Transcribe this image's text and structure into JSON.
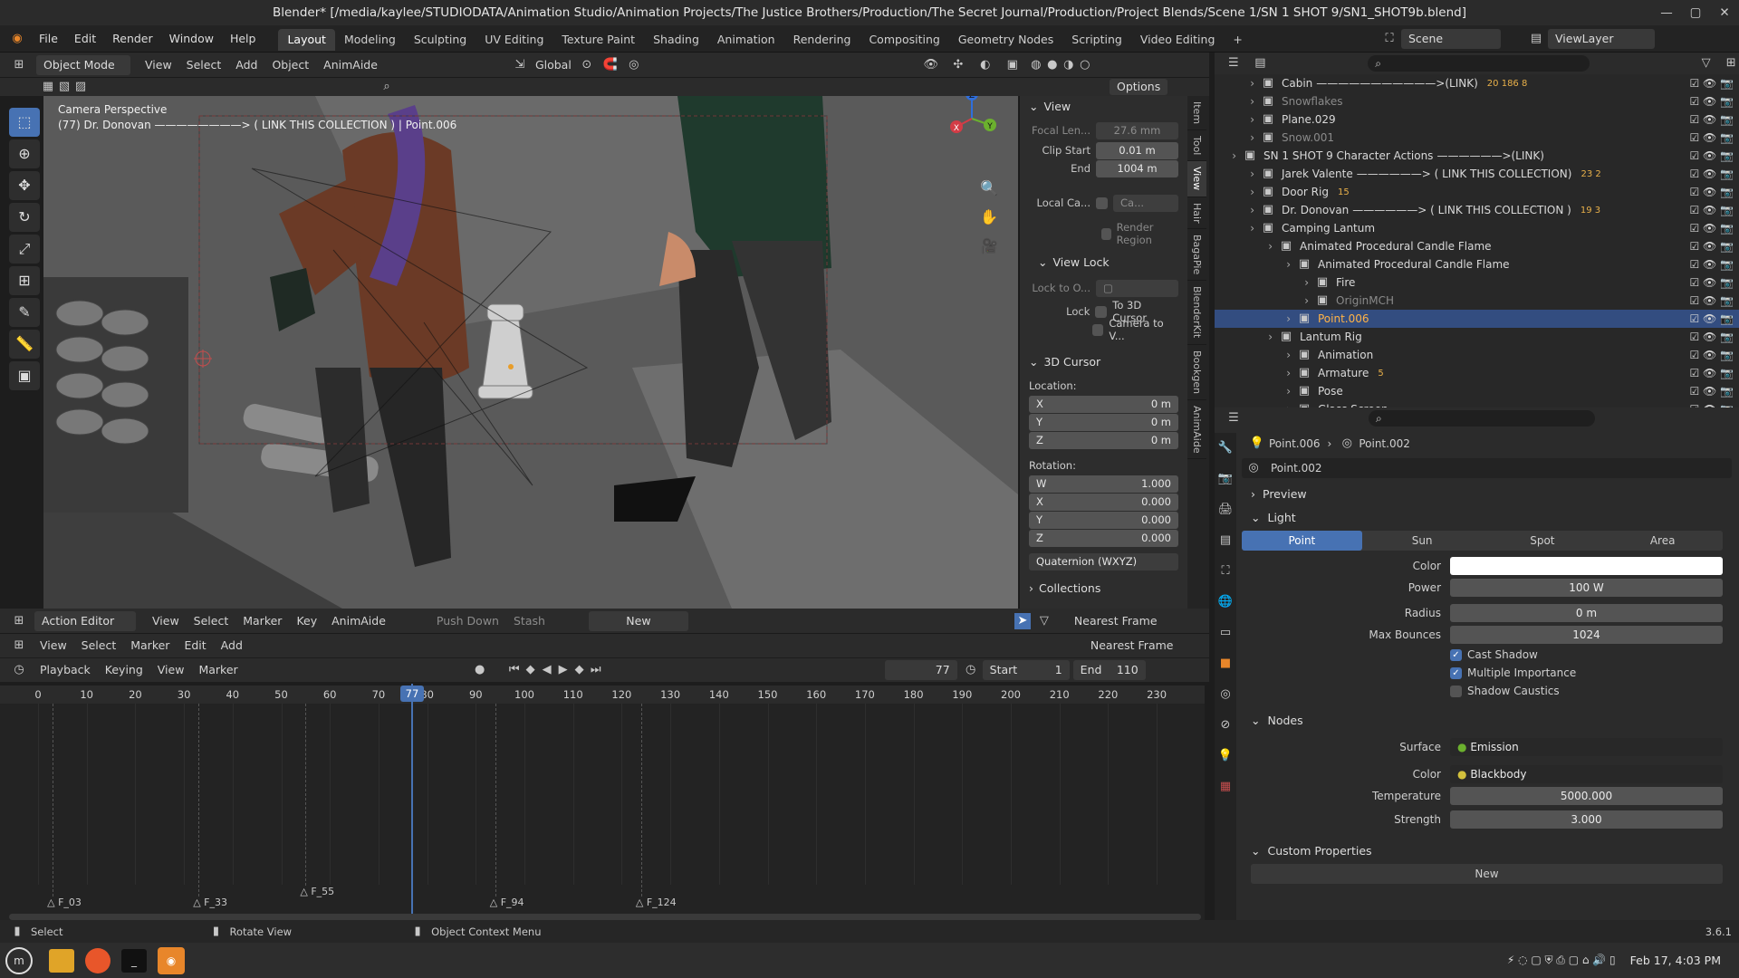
{
  "window": {
    "title": "Blender* [/media/kaylee/STUDIODATA/Animation Studio/Animation Projects/The Justice Brothers/Production/The Secret Journal/Production/Project Blends/Scene 1/SN 1 SHOT 9/SN1_SHOT9b.blend]"
  },
  "menu": {
    "items": [
      "File",
      "Edit",
      "Render",
      "Window",
      "Help"
    ]
  },
  "workspaces": [
    "Layout",
    "Modeling",
    "Sculpting",
    "UV Editing",
    "Texture Paint",
    "Shading",
    "Animation",
    "Rendering",
    "Compositing",
    "Geometry Nodes",
    "Scripting",
    "Video Editing"
  ],
  "scene": {
    "label": "Scene",
    "view_layer": "ViewLayer"
  },
  "viewport_header": {
    "mode": "Object Mode",
    "items": [
      "View",
      "Select",
      "Add",
      "Object",
      "AnimAide"
    ],
    "orientation": "Global",
    "options": "Options"
  },
  "viewport": {
    "camera_title": "Camera Perspective",
    "camera_subtitle": "(77) Dr. Donovan ————————> ( LINK THIS COLLECTION ) | Point.006",
    "axis": {
      "x": "X",
      "y": "Y",
      "z": "Z"
    }
  },
  "npanel": {
    "view_title": "View",
    "focal_label": "Focal Len...",
    "focal_value": "27.6 mm",
    "clip_start_label": "Clip Start",
    "clip_start_value": "0.01 m",
    "clip_end_label": "End",
    "clip_end_value": "1004 m",
    "local_cam_label": "Local Ca...",
    "local_cam_value": "Ca...",
    "render_region": "Render Region",
    "view_lock_title": "View Lock",
    "lock_to_label": "Lock to O...",
    "lock_label": "Lock",
    "to_cursor": "To 3D Cursor",
    "camera_to_view": "Camera to V...",
    "cursor_title": "3D Cursor",
    "location_label": "Location:",
    "loc": [
      {
        "axis": "X",
        "value": "0 m"
      },
      {
        "axis": "Y",
        "value": "0 m"
      },
      {
        "axis": "Z",
        "value": "0 m"
      }
    ],
    "rotation_label": "Rotation:",
    "rot": [
      {
        "axis": "W",
        "value": "1.000"
      },
      {
        "axis": "X",
        "value": "0.000"
      },
      {
        "axis": "Y",
        "value": "0.000"
      },
      {
        "axis": "Z",
        "value": "0.000"
      }
    ],
    "rotation_mode": "Quaternion (WXYZ)",
    "collections_title": "Collections",
    "side_tabs": [
      "Item",
      "Tool",
      "View",
      "Hair",
      "BagaPie",
      "BlenderKit",
      "Bookgen",
      "AnimAide"
    ]
  },
  "outliner": {
    "rows": [
      {
        "name": "Cabin",
        "suffix": "———————————>(LINK)",
        "badge": "20 186 8",
        "indent": 1
      },
      {
        "name": "Snowflakes",
        "suffix": "",
        "badge": "",
        "indent": 1,
        "dim": true
      },
      {
        "name": "Plane.029",
        "suffix": "",
        "badge": "",
        "indent": 1
      },
      {
        "name": "Snow.001",
        "suffix": "",
        "badge": "",
        "indent": 1,
        "dim": true
      },
      {
        "name": "SN 1 SHOT 9 Character Actions",
        "suffix": "——————>(LINK)",
        "badge": "",
        "indent": 0
      },
      {
        "name": "Jarek Valente",
        "suffix": "——————> ( LINK THIS COLLECTION)",
        "badge": "23 2",
        "indent": 1
      },
      {
        "name": "Door Rig",
        "suffix": "",
        "badge": "15",
        "indent": 1
      },
      {
        "name": "Dr. Donovan",
        "suffix": "——————> ( LINK THIS COLLECTION )",
        "badge": "19 3",
        "indent": 1
      },
      {
        "name": "Camping Lantum",
        "suffix": "",
        "badge": "",
        "indent": 1
      },
      {
        "name": "Animated Procedural Candle Flame",
        "suffix": "",
        "badge": "",
        "indent": 2
      },
      {
        "name": "Animated Procedural Candle Flame",
        "suffix": "",
        "badge": "",
        "indent": 3
      },
      {
        "name": "Fire",
        "suffix": "",
        "badge": "",
        "indent": 4
      },
      {
        "name": "OriginMCH",
        "suffix": "",
        "badge": "",
        "indent": 4,
        "dim": true
      },
      {
        "name": "Point.006",
        "suffix": "",
        "badge": "",
        "indent": 3,
        "hl": true
      },
      {
        "name": "Lantum Rig",
        "suffix": "",
        "badge": "",
        "indent": 2
      },
      {
        "name": "Animation",
        "suffix": "",
        "badge": "",
        "indent": 3
      },
      {
        "name": "Armature",
        "suffix": "",
        "badge": "5",
        "indent": 3
      },
      {
        "name": "Pose",
        "suffix": "",
        "badge": "",
        "indent": 3
      },
      {
        "name": "Glass Screen",
        "suffix": "",
        "badge": "",
        "indent": 3
      }
    ]
  },
  "properties": {
    "breadcrumb_obj": "Point.006",
    "breadcrumb_data": "Point.002",
    "datablock": "Point.002",
    "preview_title": "Preview",
    "light_title": "Light",
    "light_types": [
      "Point",
      "Sun",
      "Spot",
      "Area"
    ],
    "color_label": "Color",
    "power_label": "Power",
    "power_value": "100 W",
    "radius_label": "Radius",
    "radius_value": "0 m",
    "bounces_label": "Max Bounces",
    "bounces_value": "1024",
    "cast_shadow": "Cast Shadow",
    "multi_importance": "Multiple Importance",
    "shadow_caustics": "Shadow Caustics",
    "nodes_title": "Nodes",
    "surface_label": "Surface",
    "surface_value": "Emission",
    "color2_label": "Color",
    "color2_value": "Blackbody",
    "temp_label": "Temperature",
    "temp_value": "5000.000",
    "strength_label": "Strength",
    "strength_value": "3.000",
    "custom_title": "Custom Properties",
    "new_label": "New"
  },
  "action_editor": {
    "mode": "Action Editor",
    "items": [
      "View",
      "Select",
      "Marker",
      "Key",
      "AnimAide"
    ],
    "push_down": "Push Down",
    "stash": "Stash",
    "new": "New",
    "snap": "Nearest Frame"
  },
  "graph_hdr": {
    "items": [
      "View",
      "Select",
      "Marker",
      "Edit",
      "Add"
    ],
    "snap": "Nearest Frame"
  },
  "playback": {
    "items": [
      "Playback",
      "Keying",
      "View",
      "Marker"
    ],
    "current": "77",
    "start_label": "Start",
    "start": "1",
    "end_label": "End",
    "end": "110"
  },
  "ruler": {
    "ticks": [
      "0",
      "10",
      "20",
      "30",
      "40",
      "50",
      "60",
      "70",
      "80",
      "90",
      "100",
      "110",
      "120",
      "130",
      "140",
      "150",
      "160",
      "170",
      "180",
      "190",
      "200",
      "210",
      "220",
      "230"
    ],
    "current": "77"
  },
  "markers": [
    "F_03",
    "F_33",
    "F_55",
    "F_94",
    "F_124"
  ],
  "status": {
    "select": "Select",
    "rotate": "Rotate View",
    "context": "Object Context Menu",
    "version": "3.6.1"
  },
  "taskbar": {
    "datetime": "Feb 17, 4:03 PM"
  }
}
